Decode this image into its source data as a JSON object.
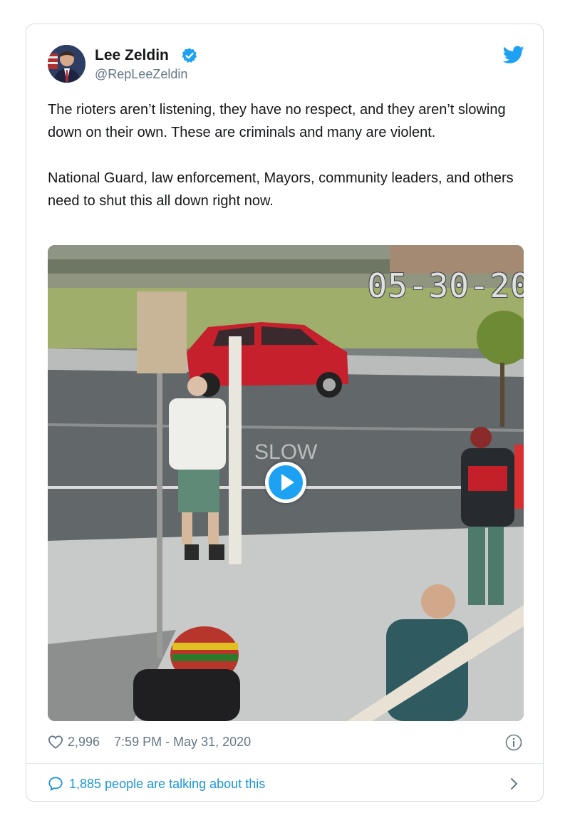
{
  "tweet": {
    "author": {
      "name": "Lee Zeldin",
      "handle": "@RepLeeZeldin",
      "verified_icon": "verified-badge-icon",
      "avatar_icon": "avatar"
    },
    "brand_icon": "twitter-bird-icon",
    "brand_color": "#1da1f2",
    "text": {
      "paragraph_1": "The rioters aren’t listening, they have no respect, and they aren’t slowing down on their own. These are criminals and many are violent.",
      "paragraph_2": "National Guard, law enforcement, Mayors, community leaders, and others need to shut this all down right now."
    },
    "media": {
      "type": "video",
      "overlay_timestamp": "05-30-20",
      "play_icon": "play-icon"
    },
    "likes": "2,996",
    "time": "7:59 PM - May 31, 2020",
    "info_icon": "info-icon",
    "talking": "1,885 people are talking about this",
    "talking_icon": "speech-bubble-icon",
    "chevron_icon": "chevron-right-icon"
  }
}
